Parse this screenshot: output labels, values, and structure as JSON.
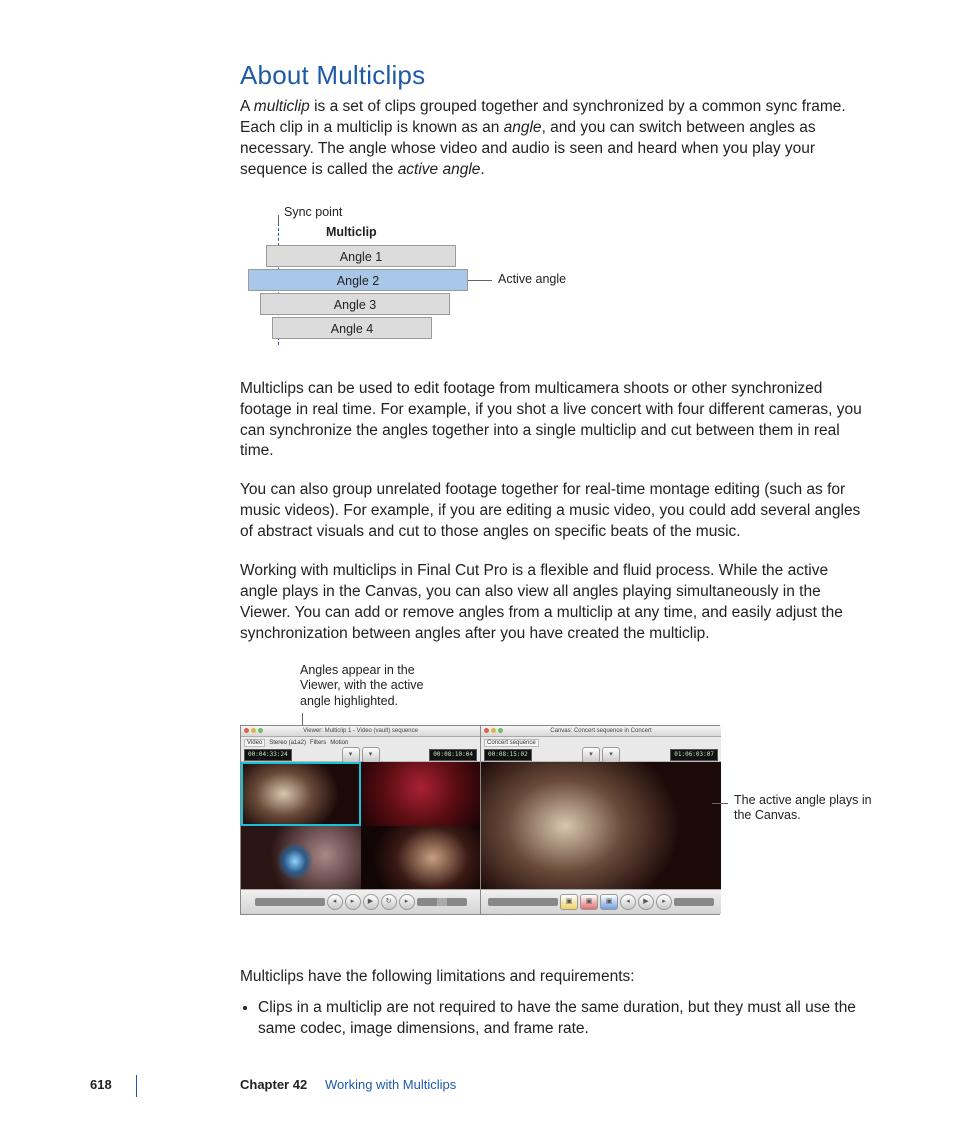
{
  "heading": "About Multiclips",
  "para1_a": "A ",
  "para1_term1": "multiclip",
  "para1_b": " is a set of clips grouped together and synchronized by a common sync frame. Each clip in a multiclip is known as an ",
  "para1_term2": "angle",
  "para1_c": ", and you can switch between angles as necessary. The angle whose video and audio is seen and heard when you play your sequence is called the ",
  "para1_term3": "active angle",
  "para1_d": ".",
  "diagram": {
    "sync_point": "Sync point",
    "multiclip": "Multiclip",
    "angle1": "Angle 1",
    "angle2": "Angle 2",
    "angle3": "Angle 3",
    "angle4": "Angle 4",
    "active_angle": "Active angle"
  },
  "para2": "Multiclips can be used to edit footage from multicamera shoots or other synchronized footage in real time. For example, if you shot a live concert with four different cameras, you can synchronize the angles together into a single multiclip and cut between them in real time.",
  "para3": "You can also group unrelated footage together for real-time montage editing (such as for music videos). For example, if you are editing a music video, you could add several angles of abstract visuals and cut to those angles on specific beats of the music.",
  "para4": "Working with multiclips in Final Cut Pro is a flexible and fluid process. While the active angle plays in the Canvas, you can also view all angles playing simultaneously in the Viewer. You can add or remove angles from a multiclip at any time, and easily adjust the synchronization between angles after you have created the multiclip.",
  "figure": {
    "caption_left": "Angles appear in the Viewer, with the active angle highlighted.",
    "caption_right": "The active angle plays in the Canvas.",
    "viewer_title": "Viewer: Multiclip 1 - Video (vault) sequence",
    "canvas_title": "Canvas: Concert sequence in Concert",
    "tab_video": "Video",
    "tab_stereo": "Stereo (a1a2)",
    "tab_filters": "Filters",
    "tab_motion": "Motion",
    "tab_seq": "Concert sequence",
    "tc1": "00:04:33:24",
    "tc2": "00:08:10:04",
    "tc3": "00:08:15:02",
    "tc4": "01:06:03:07"
  },
  "para5": "Multiclips have the following limitations and requirements:",
  "bullet1": "Clips in a multiclip are not required to have the same duration, but they must all use the same codec, image dimensions, and frame rate.",
  "footer": {
    "page": "618",
    "chapter": "Chapter 42",
    "title": "Working with Multiclips"
  }
}
